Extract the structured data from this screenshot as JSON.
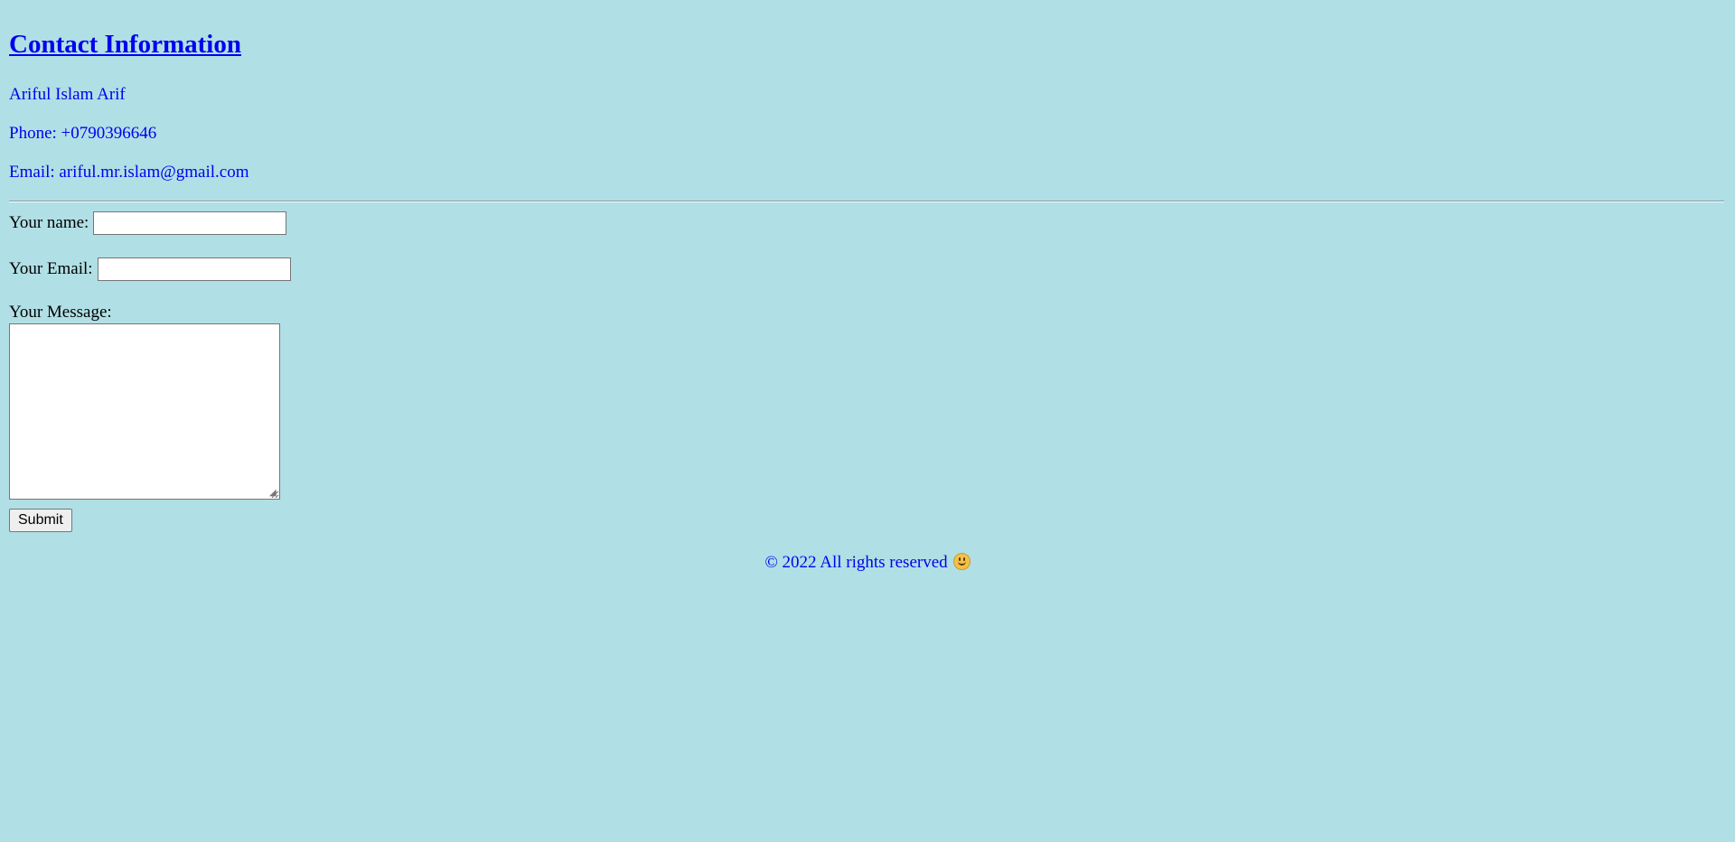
{
  "contact": {
    "title": "Contact Information",
    "name": "Ariful Islam Arif",
    "phone": "Phone: +0790396646",
    "email": "Email: ariful.mr.islam@gmail.com"
  },
  "form": {
    "name_label": "Your name:",
    "name_value": "",
    "email_label": "Your Email:",
    "email_value": "",
    "message_label": "Your Message:",
    "message_value": "",
    "submit_label": "Submit"
  },
  "footer": {
    "text": "© 2022 All rights reserved",
    "icon": "smiley-icon"
  },
  "colors": {
    "background": "#b0dfe5",
    "link": "#0000ee"
  }
}
